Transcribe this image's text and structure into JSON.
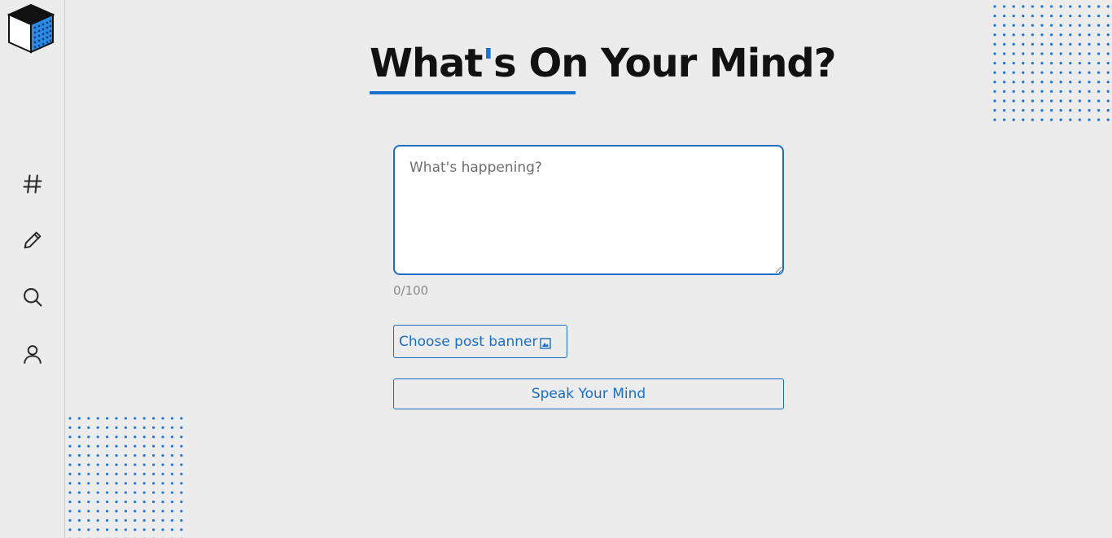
{
  "heading": {
    "part1": "What",
    "apostrophe": "'",
    "part2": "s On Your Mind?"
  },
  "composer": {
    "placeholder": "What's happening?",
    "value": "",
    "char_count": "0/100",
    "banner_button_label": "Choose post banner",
    "submit_label": "Speak Your Mind"
  },
  "sidebar": {
    "items": [
      {
        "name": "hashtag",
        "icon": "hashtag-icon"
      },
      {
        "name": "write",
        "icon": "pencil-icon"
      },
      {
        "name": "search",
        "icon": "search-icon"
      },
      {
        "name": "profile",
        "icon": "user-icon"
      }
    ]
  },
  "colors": {
    "accent": "#1a73d1",
    "background": "#ececec",
    "text": "#111111"
  }
}
